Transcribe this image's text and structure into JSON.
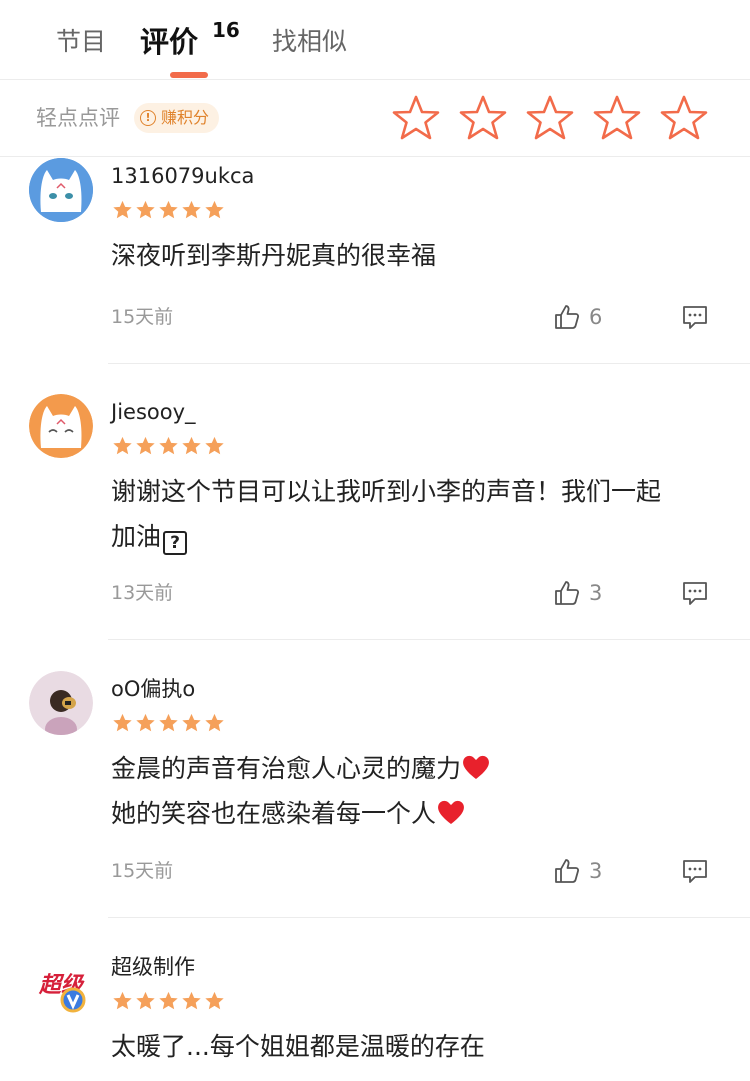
{
  "tabs": [
    {
      "label": "节目"
    },
    {
      "label": "评价",
      "count": "16"
    },
    {
      "label": "找相似"
    }
  ],
  "quick_review": {
    "label": "轻点点评",
    "badge": "赚积分",
    "badge_icon": "info-icon"
  },
  "colors": {
    "accent": "#f26b4a",
    "star": "#f5a05a",
    "badge_text": "#e0832c"
  },
  "comments": [
    {
      "username": "1316079ukca",
      "rating": 5,
      "lines": [
        "深夜听到李斯丹妮真的很幸福"
      ],
      "time": "15天前",
      "likes": "6"
    },
    {
      "username": "Jiesooy_",
      "rating": 5,
      "lines": [
        "谢谢这个节目可以让我听到小李的声音！我们一起",
        "加油"
      ],
      "emoji": "?",
      "time": "13天前",
      "likes": "3"
    },
    {
      "username": "oO偏执o",
      "rating": 5,
      "lines": [
        "金晨的声音有治愈人心灵的魔力",
        "她的笑容也在感染着每一个人"
      ],
      "time": "15天前",
      "likes": "3"
    },
    {
      "username": "超级制作",
      "rating": 5,
      "lines": [
        "太暖了...每个姐姐都是温暖的存在"
      ]
    }
  ]
}
